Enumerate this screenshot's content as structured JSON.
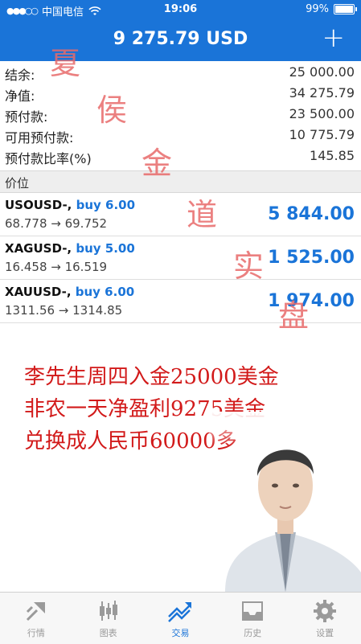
{
  "status": {
    "carrier": "中国电信",
    "time": "19:06",
    "battery": "99%",
    "battery_level": 0.99
  },
  "header": {
    "title": "9 275.79 USD",
    "add_label": "+"
  },
  "account": [
    {
      "label": "结余:",
      "value": "25 000.00"
    },
    {
      "label": "净值:",
      "value": "34 275.79"
    },
    {
      "label": "预付款:",
      "value": "23 500.00"
    },
    {
      "label": "可用预付款:",
      "value": "10 775.79"
    },
    {
      "label": "预付款比率(%)",
      "value": "145.85"
    }
  ],
  "positions_header": "价位",
  "positions": [
    {
      "symbol": "USOUSD-,",
      "action": "buy 6.00",
      "range": "68.778 → 69.752",
      "profit": "5 844.00"
    },
    {
      "symbol": "XAGUSD-,",
      "action": "buy 5.00",
      "range": "16.458 → 16.519",
      "profit": "1 525.00"
    },
    {
      "symbol": "XAUUSD-,",
      "action": "buy 6.00",
      "range": "1311.56 → 1314.85",
      "profit": "1 974.00"
    }
  ],
  "watermark": [
    "夏",
    "侯",
    "金",
    "道",
    "实",
    "盘"
  ],
  "promo": [
    "李先生周四入金25000美金",
    "非农一天净盈利9275美金",
    "兑换成人民币60000多"
  ],
  "tabs": [
    {
      "label": "行情",
      "icon": "quotes-icon",
      "active": false
    },
    {
      "label": "图表",
      "icon": "chart-icon",
      "active": false
    },
    {
      "label": "交易",
      "icon": "trade-icon",
      "active": true
    },
    {
      "label": "历史",
      "icon": "history-icon",
      "active": false
    },
    {
      "label": "设置",
      "icon": "settings-icon",
      "active": false
    }
  ],
  "colors": {
    "brand": "#1a74d8",
    "promo": "#d21a1a",
    "watermark": "#e86a6a"
  }
}
